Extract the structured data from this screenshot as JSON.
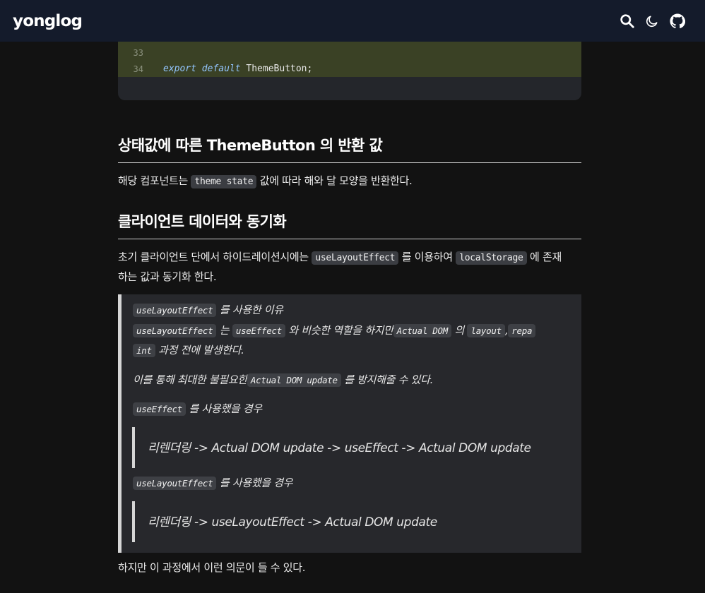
{
  "header": {
    "logo": "yonglog",
    "icons": [
      "search-icon",
      "moon-icon",
      "github-icon"
    ]
  },
  "code": {
    "lines": [
      {
        "num": "33",
        "text": ""
      },
      {
        "num": "34",
        "kw": "export default",
        "text": "ThemeButton;"
      }
    ]
  },
  "section1": {
    "heading": "상태값에 따른 ThemeButton 의 반환 값",
    "p_before": "해당 컴포넌트는",
    "p_code": "theme state",
    "p_after": "값에 따라 해와 달 모양을 반환한다."
  },
  "section2": {
    "heading": "클라이언트 데이터와 동기화",
    "p_before": "초기 클라이언트 단에서 하이드레이션시에는",
    "p_code1": "useLayoutEffect",
    "p_mid": "를 이용하여",
    "p_code2": "localStorage",
    "p_after_line1": "에 존재",
    "p_after_line2": "하는 값과 동기화 한다."
  },
  "quote": {
    "l1_code": "useLayoutEffect",
    "l1_text": "를 사용한 이유",
    "l2_code1": "useLayoutEffect",
    "l2_t1": "는",
    "l2_code2": "useEffect",
    "l2_t2": "와 비슷한 역할을 하지만",
    "l2_code3": "Actual DOM",
    "l2_t3": "의",
    "l2_code4": "layout",
    "l2_t4": ",",
    "l2_code5a": "repa",
    "l3_code5b": "int",
    "l3_text": "과정 전에 발생한다.",
    "l4_before": "이를 통해 최대한 불필요한",
    "l4_code": "Actual DOM update",
    "l4_after": "를 방지해줄 수 있다.",
    "l5_code": "useEffect",
    "l5_text": "를 사용했을 경우",
    "nested1": "리렌더링 -> Actual DOM update -> useEffect -> Actual DOM update",
    "l6_code": "useLayoutEffect",
    "l6_text": "를 사용했을 경우",
    "nested2": "리렌더링 -> useLayoutEffect -> Actual DOM update"
  },
  "after_quote": "하지만 이 과정에서 이런 의문이 들 수 있다."
}
